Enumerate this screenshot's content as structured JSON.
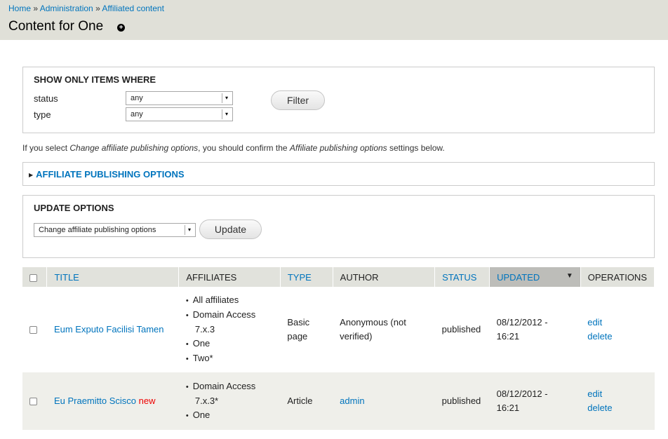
{
  "breadcrumb": {
    "home": "Home",
    "sep1": " » ",
    "admin": "Administration",
    "sep2": " » ",
    "affiliated": "Affiliated content"
  },
  "page_title": "Content for One",
  "add_shortcut_icon": "+",
  "filter": {
    "legend": "Show only items where",
    "status_label": "status",
    "status_value": "any",
    "type_label": "type",
    "type_value": "any",
    "filter_button": "Filter"
  },
  "description": {
    "part1": "If you select ",
    "em1": "Change affiliate publishing options",
    "part2": ", you should confirm the ",
    "em2": "Affiliate publishing options",
    "part3": " settings below."
  },
  "affiliate_options": {
    "legend": "Affiliate publishing options"
  },
  "update": {
    "legend": "Update options",
    "select_value": "Change affiliate publishing options",
    "update_button": "Update"
  },
  "table": {
    "headers": {
      "title": "Title",
      "affiliates": "Affiliates",
      "type": "Type",
      "author": "Author",
      "status": "Status",
      "updated": "Updated",
      "operations": "Operations"
    },
    "rows": [
      {
        "title": "Eum Exputo Facilisi Tamen",
        "new_marker": "",
        "affiliates": [
          "All affiliates",
          "Domain Access",
          "7.x.3",
          "One",
          "Two*"
        ],
        "type_line1": "Basic",
        "type_line2": "page",
        "author_line1": "Anonymous (not",
        "author_line2": "verified)",
        "status": "published",
        "updated_line1": "08/12/2012 -",
        "updated_line2": "16:21",
        "edit": "edit",
        "delete": "delete"
      },
      {
        "title": "Eu Praemitto Scisco",
        "new_marker": "new",
        "affiliates": [
          "Domain Access",
          "7.x.3*",
          "One"
        ],
        "type": "Article",
        "author": "admin",
        "status": "published",
        "updated_line1": "08/12/2012 -",
        "updated_line2": "16:21",
        "edit": "edit",
        "delete": "delete"
      }
    ]
  }
}
